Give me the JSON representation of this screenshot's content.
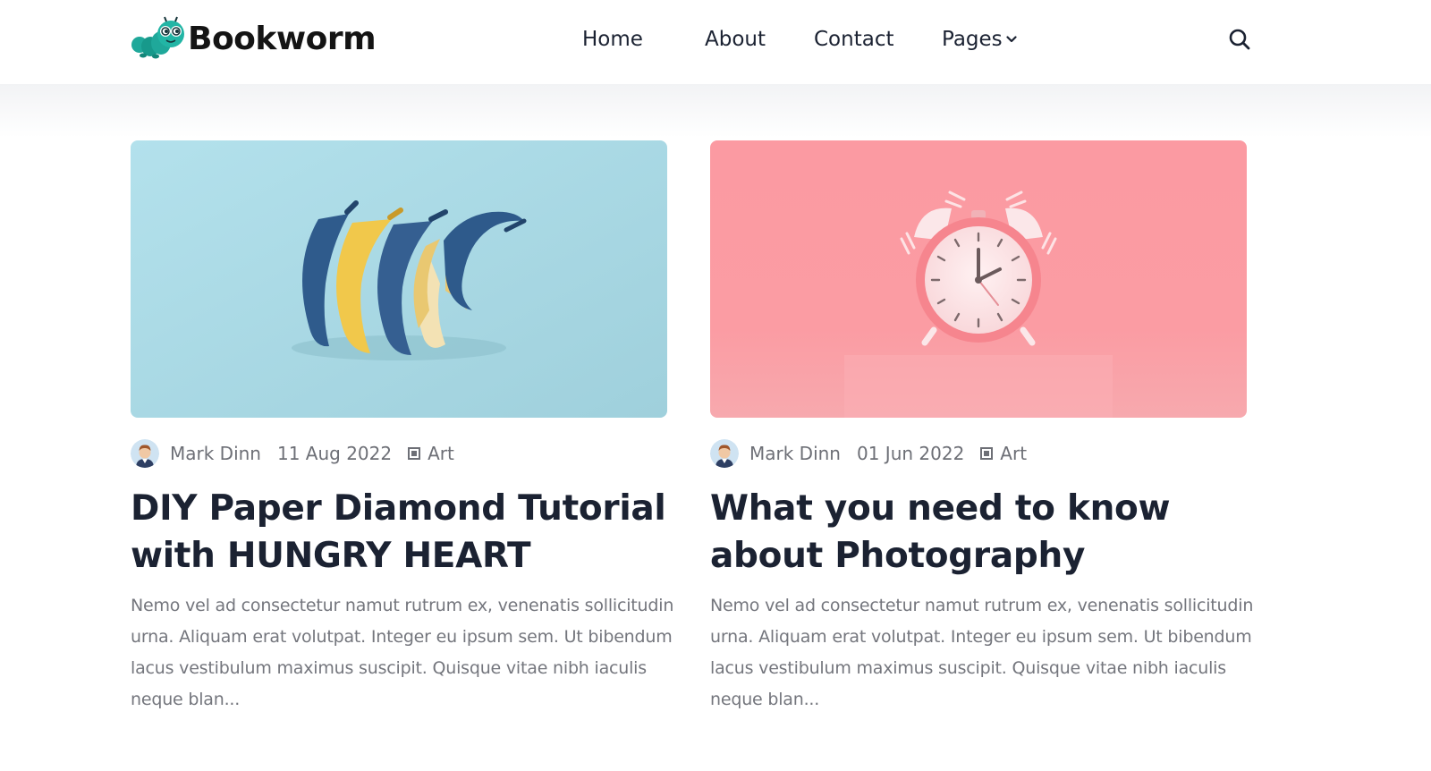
{
  "brand": {
    "name": "Bookworm",
    "accent": "#1fa89a"
  },
  "nav": {
    "items": [
      {
        "label": "Home"
      },
      {
        "label": "About"
      },
      {
        "label": "Contact"
      },
      {
        "label": "Pages"
      }
    ],
    "search_icon": "search-icon",
    "dropdown_icon": "chevron-down-icon"
  },
  "posts": [
    {
      "image": "blue-and-yellow-bananas",
      "author": "Mark Dinn",
      "date": "11 Aug 2022",
      "category": "Art",
      "title": "DIY Paper Diamond Tutorial with HUNGRY HEART",
      "excerpt": "Nemo vel ad consectetur namut rutrum ex, venenatis sollicitudin urna. Aliquam erat volutpat. Integer eu ipsum sem. Ut bibendum lacus vestibulum maximus suscipit. Quisque vitae nibh iaculis neque blan..."
    },
    {
      "image": "pink-alarm-clock",
      "author": "Mark Dinn",
      "date": "01 Jun 2022",
      "category": "Art",
      "title": "What you need to know about Photography",
      "excerpt": "Nemo vel ad consectetur namut rutrum ex, venenatis sollicitudin urna. Aliquam erat volutpat. Integer eu ipsum sem. Ut bibendum lacus vestibulum maximus suscipit. Quisque vitae nibh iaculis neque blan..."
    }
  ],
  "colors": {
    "heading": "#1b2232",
    "body_text": "#74767d",
    "meta_text": "#6d6f76",
    "image1_bg": "#a8d9e4",
    "image2_bg": "#fb9aa1"
  }
}
